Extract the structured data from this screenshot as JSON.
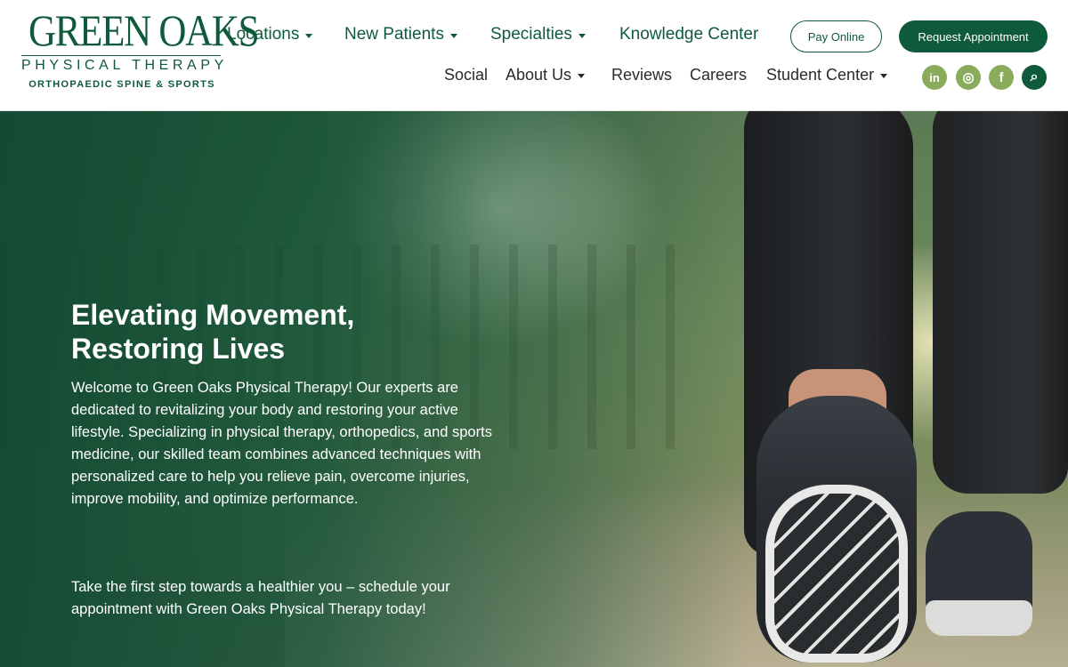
{
  "brand": {
    "name": "GREEN OAKS",
    "subtitle": "PHYSICAL THERAPY",
    "tagline": "ORTHOPAEDIC SPINE & SPORTS",
    "primary_color": "#0f5a3a",
    "accent_color": "#8aab5c"
  },
  "nav": {
    "primary": [
      {
        "label": "Locations",
        "has_dropdown": true
      },
      {
        "label": "New Patients",
        "has_dropdown": true
      },
      {
        "label": "Specialties",
        "has_dropdown": true
      },
      {
        "label": "Knowledge Center",
        "has_dropdown": false
      }
    ],
    "secondary": [
      {
        "label": "Social",
        "has_dropdown": false
      },
      {
        "label": "About Us",
        "has_dropdown": true
      },
      {
        "label": "Reviews",
        "has_dropdown": false
      },
      {
        "label": "Careers",
        "has_dropdown": false
      },
      {
        "label": "Student Center",
        "has_dropdown": true
      }
    ]
  },
  "buttons": {
    "pay_online": "Pay Online",
    "request_appointment": "Request Appointment"
  },
  "social": {
    "linkedin": {
      "glyph": "in",
      "icon": "linkedin-icon"
    },
    "instagram": {
      "glyph": "◎",
      "icon": "instagram-icon"
    },
    "facebook": {
      "glyph": "f",
      "icon": "facebook-icon"
    },
    "search": {
      "glyph": "⌕",
      "icon": "search-icon"
    }
  },
  "hero": {
    "title_line1": "Elevating Movement,",
    "title_line2": "Restoring Lives",
    "paragraph": "Welcome to Green Oaks Physical Therapy! Our experts are dedicated to revitalizing your body and restoring your active lifestyle. Specializing in physical therapy, orthopedics, and sports medicine, our skilled team combines advanced techniques with personalized care to help you relieve pain, overcome injuries, improve mobility, and optimize performance.",
    "cta": "Take the first step towards a healthier you – schedule your appointment with Green Oaks Physical Therapy today!"
  }
}
